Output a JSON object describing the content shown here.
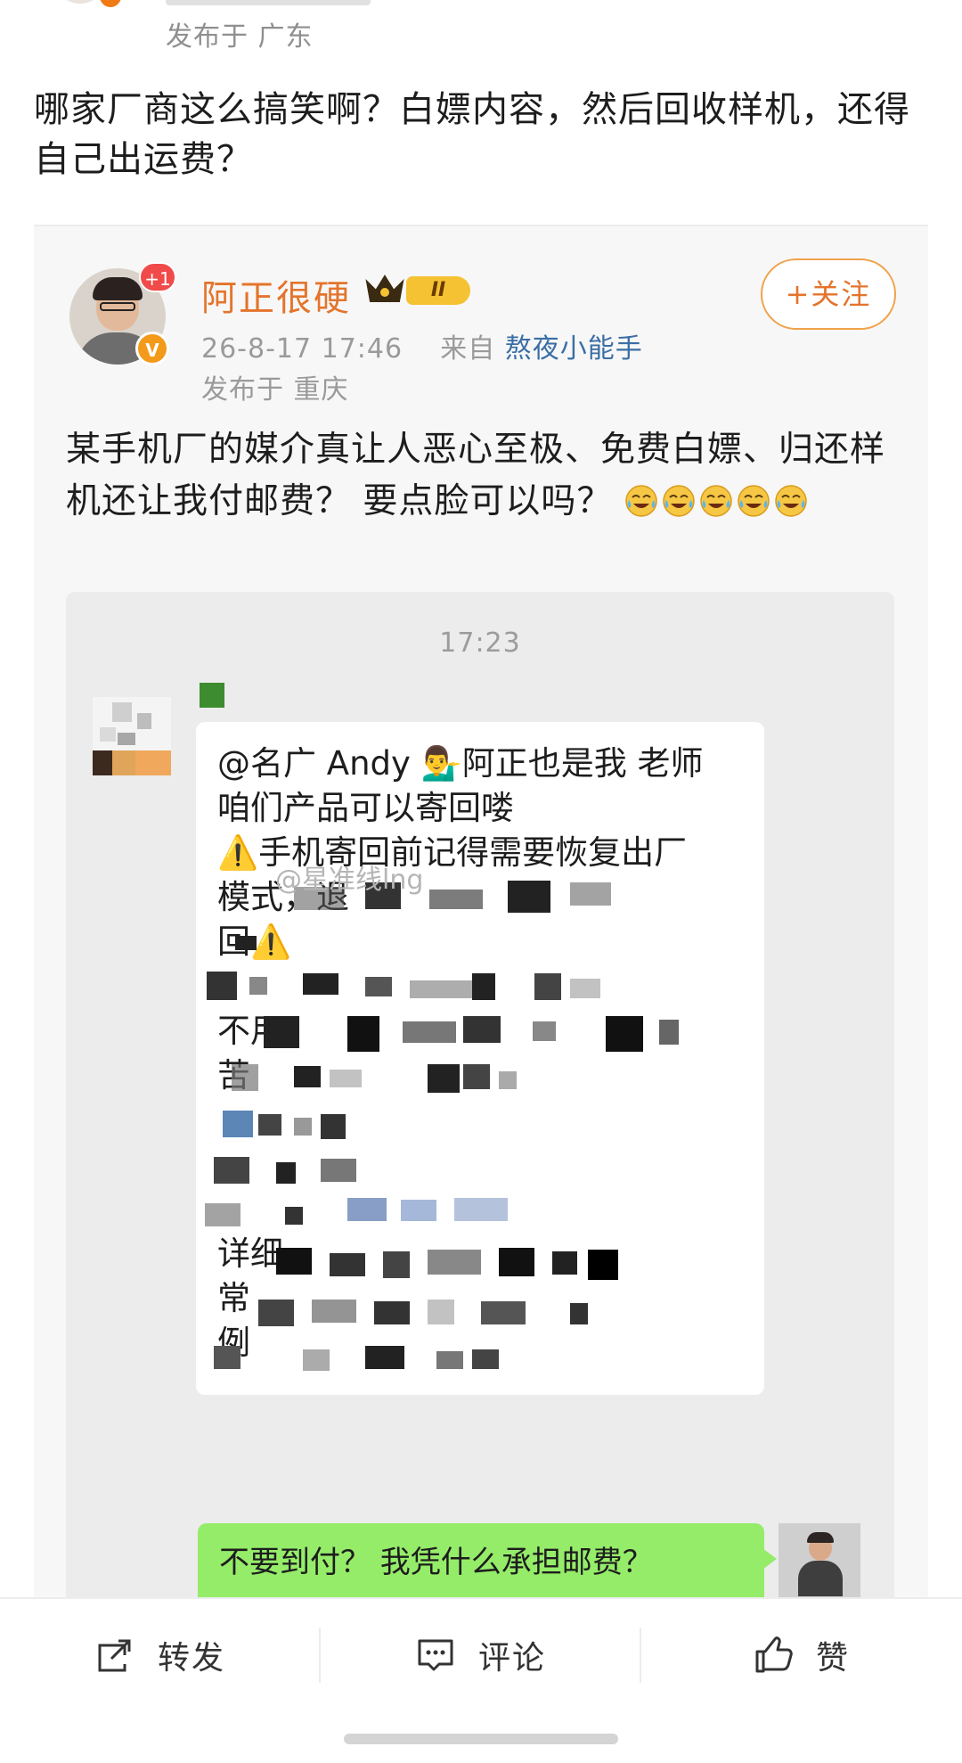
{
  "outer_post": {
    "location": "发布于 广东",
    "text": "哪家厂商这么搞笑啊？白嫖内容，然后回收样机，还得自己出运费？"
  },
  "repost": {
    "author": {
      "name": "阿正很硬",
      "notification_badge": "+1",
      "verified_badge": "V",
      "level": "II",
      "follow_label": "+关注"
    },
    "meta": {
      "datetime": "26-8-17 17:46",
      "from_label": "来自",
      "source": "熬夜小能手",
      "location": "发布于 重庆"
    },
    "text": "某手机厂的媒介真让人恶心至极、免费白嫖、归还样机还让我付邮费？ 要点脸可以吗？",
    "emoji_count": 5
  },
  "chat": {
    "time": "17:23",
    "message_left_lines": [
      "@名广 Andy 💁‍♂️阿正也是我 老师",
      "咱们产品可以寄回喽",
      "⚠️手机寄回前记得需要恢复出厂",
      "模式，退",
      "回⚠️",
      "",
      "不用",
      "苦",
      "",
      "",
      "",
      "详细",
      "常",
      "例"
    ],
    "watermark": "@星准线lng",
    "message_right": "不要到付？ 我凭什么承担邮费？"
  },
  "actions": {
    "repost_label": "转发",
    "comment_label": "评论",
    "like_label": "赞"
  },
  "colors": {
    "username": "#e4742c",
    "follow_border": "#f0a24a",
    "source_link": "#3a6ea5",
    "wechat_green": "#95ec69",
    "card_background": "#f7f7f7"
  }
}
